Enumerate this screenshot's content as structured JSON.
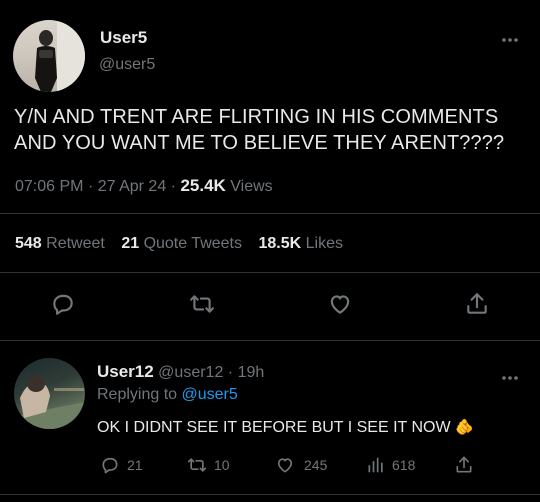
{
  "main_tweet": {
    "display_name": "User5",
    "handle": "@user5",
    "text_line1": "Y/N AND TRENT ARE FLIRTING IN HIS COMMENTS",
    "text_line2": "AND YOU WANT ME TO BELIEVE THEY ARENT????",
    "time": "07:06 PM",
    "date": "27 Apr 24",
    "views_count": "25.4K",
    "views_label": "Views",
    "retweets_count": "548",
    "retweets_label": "Retweet",
    "quotes_count": "21",
    "quotes_label": "Quote Tweets",
    "likes_count": "18.5K",
    "likes_label": "Likes",
    "separator": "·"
  },
  "reply": {
    "display_name": "User12",
    "handle": "@user12",
    "time_ago": "19h",
    "replying_prefix": "Replying to",
    "replying_to": "@user5",
    "text": "OK I DIDNT SEE IT BEFORE BUT I SEE IT NOW",
    "emoji": "🫵",
    "reply_count": "21",
    "retweet_count": "10",
    "like_count": "245",
    "views_count": "618",
    "separator": "·"
  },
  "colors": {
    "background": "#000000",
    "text": "#e7e9ea",
    "muted": "#71767b",
    "link": "#1d9bf0",
    "divider": "#2f3336"
  }
}
